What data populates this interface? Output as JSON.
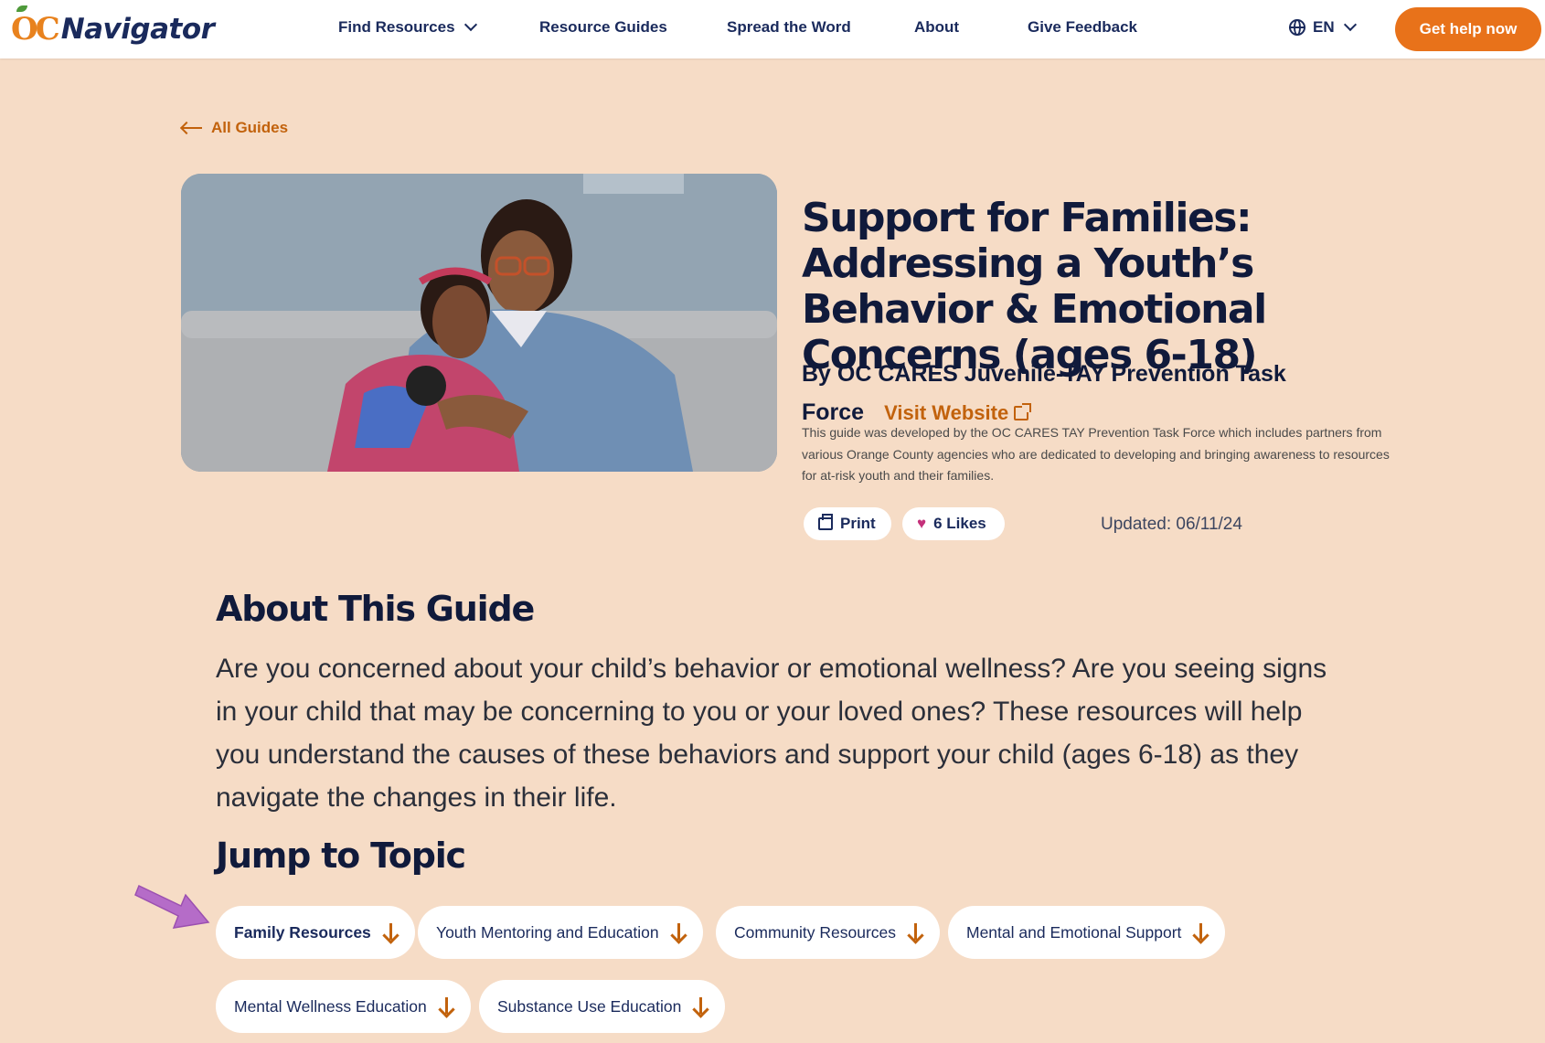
{
  "header": {
    "logo_mark": "OC",
    "logo_text": "Navigator",
    "nav": {
      "find_resources": "Find Resources",
      "resource_guides": "Resource Guides",
      "spread_the_word": "Spread the Word",
      "about": "About",
      "give_feedback": "Give Feedback"
    },
    "language": "EN",
    "cta_label": "Get help now"
  },
  "back_link": "All Guides",
  "guide": {
    "title": "Support for Families: Addressing a Youth’s Behavior & Emotional Concerns (ages 6-18)",
    "author": "By OC CARES Juvenile-TAY Prevention Task Force",
    "visit_label": "Visit Website",
    "description": "This guide was developed by the OC CARES TAY Prevention Task Force which includes partners from various Orange County agencies who are dedicated to developing and bringing awareness to resources for at-risk youth and their families.",
    "print_label": "Print",
    "likes_label": "6 Likes",
    "updated": "Updated: 06/11/24"
  },
  "about": {
    "heading": "About This Guide",
    "body": "Are you concerned about your child’s behavior or emotional wellness? Are you seeing signs in your child that may be concerning to you or your loved ones? These resources will help you understand the causes of these behaviors and support your child (ages 6-18) as they navigate the changes in their life."
  },
  "jump": {
    "heading": "Jump to Topic",
    "topics": [
      "Family Resources",
      "Youth Mentoring and Education",
      "Community Resources",
      "Mental and Emotional Support",
      "Mental Wellness Education",
      "Substance Use Education"
    ]
  },
  "colors": {
    "background": "#f6dcc6",
    "accent": "#e8721a",
    "link": "#c2620c",
    "navy": "#101a3b",
    "annotation_arrow": "#b56cc8"
  }
}
